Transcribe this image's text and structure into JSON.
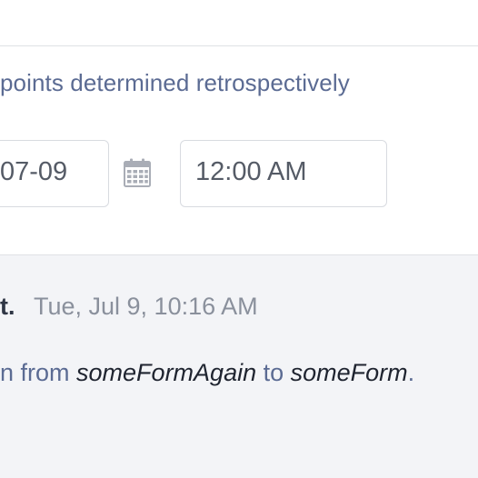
{
  "form": {
    "hint": "points determined retrospectively",
    "date_value": "07-09",
    "time_value": "12:00 AM",
    "calendar_icon": "calendar-icon"
  },
  "activity": {
    "author_suffix": "t.",
    "timestamp": "Tue, Jul 9, 10:16 AM",
    "change": {
      "prefix": "n from ",
      "from_value": "someFormAgain",
      "middle": " to ",
      "to_value": "someForm",
      "suffix": "."
    }
  }
}
